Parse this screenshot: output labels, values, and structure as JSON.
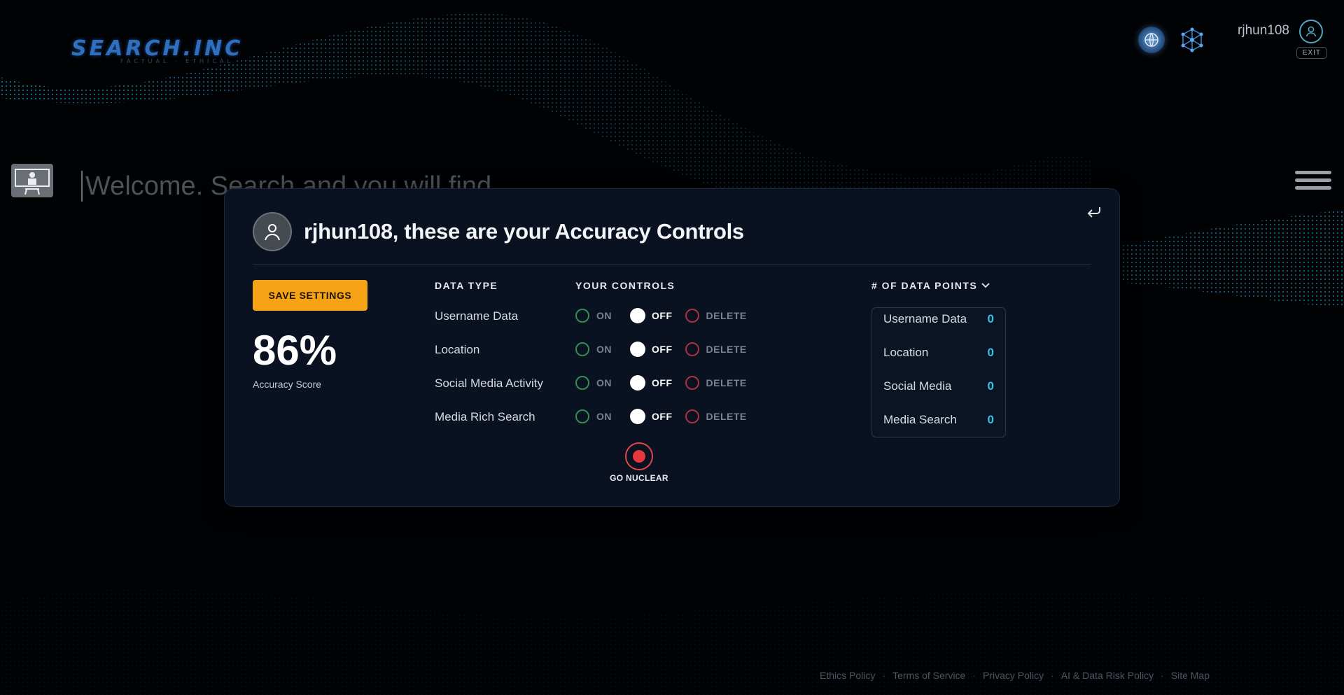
{
  "header": {
    "logo_text": "SEARCH.INC",
    "logo_tagline": "FACTUAL · ETHICAL",
    "username": "rjhun108",
    "exit_label": "EXIT"
  },
  "search": {
    "placeholder": "Welcome. Search and you will find"
  },
  "modal": {
    "title": "rjhun108, these are your Accuracy Controls",
    "save_label": "SAVE SETTINGS",
    "accuracy_value": "86%",
    "accuracy_label": "Accuracy Score",
    "col_data_type": "DATA TYPE",
    "col_controls": "YOUR CONTROLS",
    "col_points": "# OF DATA POINTS",
    "option_labels": {
      "on": "ON",
      "off": "OFF",
      "delete": "DELETE"
    },
    "rows": [
      {
        "label": "Username Data",
        "selected": "OFF"
      },
      {
        "label": "Location",
        "selected": "OFF"
      },
      {
        "label": "Social Media Activity",
        "selected": "OFF"
      },
      {
        "label": "Media Rich Search",
        "selected": "OFF"
      }
    ],
    "nuclear_label": "GO NUCLEAR",
    "data_points": [
      {
        "label": "Username Data",
        "value": "0"
      },
      {
        "label": "Location",
        "value": "0"
      },
      {
        "label": "Social Media",
        "value": "0"
      },
      {
        "label": "Media Search",
        "value": "0"
      }
    ]
  },
  "footer": {
    "links": [
      "Ethics Policy",
      "Terms of Service",
      "Privacy Policy",
      "AI & Data Risk Policy",
      "Site Map"
    ]
  },
  "colors": {
    "accent_orange": "#f5a314",
    "on_green": "#2e8f57",
    "delete_red": "#a8343a",
    "points_cyan": "#2fc3e8",
    "logo_blue": "#2f6fc0"
  },
  "icons": {
    "globe": "globe-icon",
    "network": "network-icon",
    "user": "user-icon",
    "back": "back-arrow-icon",
    "menu": "hamburger-menu-icon",
    "kiosk": "kiosk-icon",
    "chevron": "chevron-down-icon"
  }
}
